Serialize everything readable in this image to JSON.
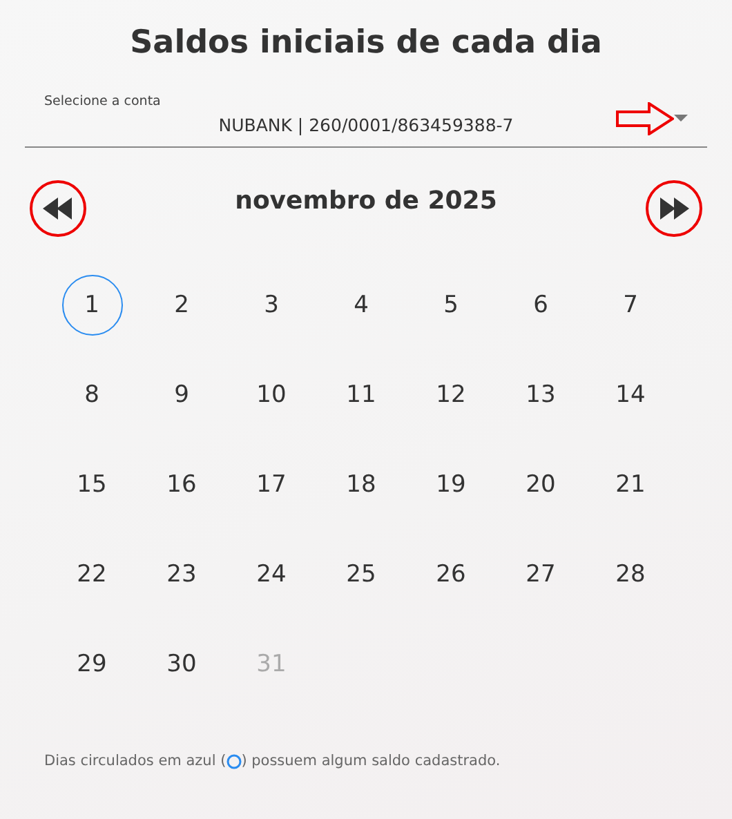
{
  "title": "Saldos iniciais de cada dia",
  "account_select": {
    "label": "Selecione a conta",
    "value": "NUBANK | 260/0001/863459388-7"
  },
  "calendar": {
    "month": "novembro de 2025",
    "days": [
      {
        "label": "1",
        "circled": true,
        "disabled": false
      },
      {
        "label": "2",
        "circled": false,
        "disabled": false
      },
      {
        "label": "3",
        "circled": false,
        "disabled": false
      },
      {
        "label": "4",
        "circled": false,
        "disabled": false
      },
      {
        "label": "5",
        "circled": false,
        "disabled": false
      },
      {
        "label": "6",
        "circled": false,
        "disabled": false
      },
      {
        "label": "7",
        "circled": false,
        "disabled": false
      },
      {
        "label": "8",
        "circled": false,
        "disabled": false
      },
      {
        "label": "9",
        "circled": false,
        "disabled": false
      },
      {
        "label": "10",
        "circled": false,
        "disabled": false
      },
      {
        "label": "11",
        "circled": false,
        "disabled": false
      },
      {
        "label": "12",
        "circled": false,
        "disabled": false
      },
      {
        "label": "13",
        "circled": false,
        "disabled": false
      },
      {
        "label": "14",
        "circled": false,
        "disabled": false
      },
      {
        "label": "15",
        "circled": false,
        "disabled": false
      },
      {
        "label": "16",
        "circled": false,
        "disabled": false
      },
      {
        "label": "17",
        "circled": false,
        "disabled": false
      },
      {
        "label": "18",
        "circled": false,
        "disabled": false
      },
      {
        "label": "19",
        "circled": false,
        "disabled": false
      },
      {
        "label": "20",
        "circled": false,
        "disabled": false
      },
      {
        "label": "21",
        "circled": false,
        "disabled": false
      },
      {
        "label": "22",
        "circled": false,
        "disabled": false
      },
      {
        "label": "23",
        "circled": false,
        "disabled": false
      },
      {
        "label": "24",
        "circled": false,
        "disabled": false
      },
      {
        "label": "25",
        "circled": false,
        "disabled": false
      },
      {
        "label": "26",
        "circled": false,
        "disabled": false
      },
      {
        "label": "27",
        "circled": false,
        "disabled": false
      },
      {
        "label": "28",
        "circled": false,
        "disabled": false
      },
      {
        "label": "29",
        "circled": false,
        "disabled": false
      },
      {
        "label": "30",
        "circled": false,
        "disabled": false
      },
      {
        "label": "31",
        "circled": false,
        "disabled": true
      }
    ]
  },
  "footnote": {
    "before": "Dias circulados em azul (",
    "after": ") possuem algum saldo cadastrado."
  }
}
